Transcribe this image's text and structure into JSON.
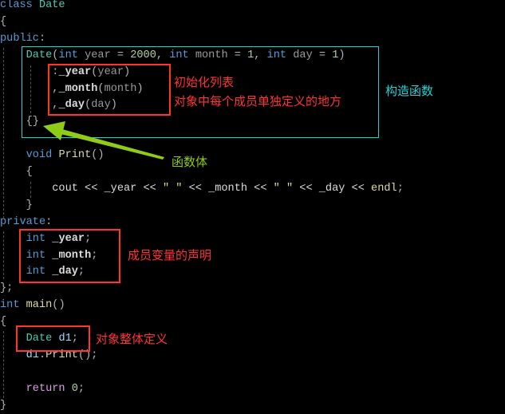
{
  "colors": {
    "constructor_box": "#22d3d6",
    "annotation_red": "#ff3333",
    "arrow_green": "#8fcc1a"
  },
  "code_lines": [
    [
      [
        "kw",
        "class "
      ],
      [
        "ty",
        "Date"
      ]
    ],
    [
      [
        "pn",
        "{"
      ]
    ],
    [
      [
        "kw",
        "public"
      ],
      [
        "pn",
        ":"
      ]
    ],
    [
      [
        "id",
        "    "
      ],
      [
        "ty",
        "Date"
      ],
      [
        "pn",
        "("
      ],
      [
        "kw",
        "int "
      ],
      [
        "par",
        "year"
      ],
      [
        "pn",
        " = "
      ],
      [
        "num",
        "2000"
      ],
      [
        "pn",
        ", "
      ],
      [
        "kw",
        "int "
      ],
      [
        "par",
        "month"
      ],
      [
        "pn",
        " = "
      ],
      [
        "num",
        "1"
      ],
      [
        "pn",
        ", "
      ],
      [
        "kw",
        "int "
      ],
      [
        "par",
        "day"
      ],
      [
        "pn",
        " = "
      ],
      [
        "num",
        "1"
      ],
      [
        "pn",
        ")"
      ]
    ],
    [
      [
        "id",
        "        "
      ],
      [
        "pn",
        ":"
      ],
      [
        "mem",
        "_year"
      ],
      [
        "pn",
        "("
      ],
      [
        "par",
        "year"
      ],
      [
        "pn",
        ")"
      ]
    ],
    [
      [
        "id",
        "        "
      ],
      [
        "pn",
        ","
      ],
      [
        "mem",
        "_month"
      ],
      [
        "pn",
        "("
      ],
      [
        "par",
        "month"
      ],
      [
        "pn",
        ")"
      ]
    ],
    [
      [
        "id",
        "        "
      ],
      [
        "pn",
        ","
      ],
      [
        "mem",
        "_day"
      ],
      [
        "pn",
        "("
      ],
      [
        "par",
        "day"
      ],
      [
        "pn",
        ")"
      ]
    ],
    [
      [
        "id",
        "    "
      ],
      [
        "pn",
        "{}"
      ]
    ],
    [],
    [
      [
        "id",
        "    "
      ],
      [
        "kw",
        "void "
      ],
      [
        "fn",
        "Print"
      ],
      [
        "pn",
        "()"
      ]
    ],
    [
      [
        "id",
        "    "
      ],
      [
        "pn",
        "{"
      ]
    ],
    [
      [
        "id",
        "        "
      ],
      [
        "id",
        "cout << _year << "
      ],
      [
        "fn",
        "\" \""
      ],
      [
        "id",
        " << _month << "
      ],
      [
        "fn",
        "\" \""
      ],
      [
        "id",
        " << _day << "
      ],
      [
        "fn",
        "endl"
      ],
      [
        "pn",
        ";"
      ]
    ],
    [
      [
        "id",
        "    "
      ],
      [
        "pn",
        "}"
      ]
    ],
    [
      [
        "kw",
        "private"
      ],
      [
        "pn",
        ":"
      ]
    ],
    [
      [
        "id",
        "    "
      ],
      [
        "kw",
        "int "
      ],
      [
        "mem",
        "_year"
      ],
      [
        "pn",
        ";"
      ]
    ],
    [
      [
        "id",
        "    "
      ],
      [
        "kw",
        "int "
      ],
      [
        "mem",
        "_month"
      ],
      [
        "pn",
        ";"
      ]
    ],
    [
      [
        "id",
        "    "
      ],
      [
        "kw",
        "int "
      ],
      [
        "mem",
        "_day"
      ],
      [
        "pn",
        ";"
      ]
    ],
    [
      [
        "pn",
        "};"
      ]
    ],
    [
      [
        "kw",
        "int "
      ],
      [
        "fn",
        "main"
      ],
      [
        "pn",
        "()"
      ]
    ],
    [
      [
        "pn",
        "{"
      ]
    ],
    [
      [
        "id",
        "    "
      ],
      [
        "ty",
        "Date "
      ],
      [
        "var",
        "d1"
      ],
      [
        "pn",
        ";"
      ]
    ],
    [
      [
        "id",
        "    "
      ],
      [
        "var",
        "d1"
      ],
      [
        "pn",
        "."
      ],
      [
        "fn",
        "Print"
      ],
      [
        "pn",
        "();"
      ]
    ],
    [],
    [
      [
        "id",
        "    "
      ],
      [
        "ctl",
        "return "
      ],
      [
        "num",
        "0"
      ],
      [
        "pn",
        ";"
      ]
    ],
    [
      [
        "pn",
        "}"
      ]
    ]
  ],
  "annotations": {
    "init_list": "初始化列表",
    "init_list_desc": "对象中每个成员单独定义的地方",
    "constructor": "构造函数",
    "function_body": "函数体",
    "member_decl": "成员变量的声明",
    "object_def": "对象整体定义"
  }
}
